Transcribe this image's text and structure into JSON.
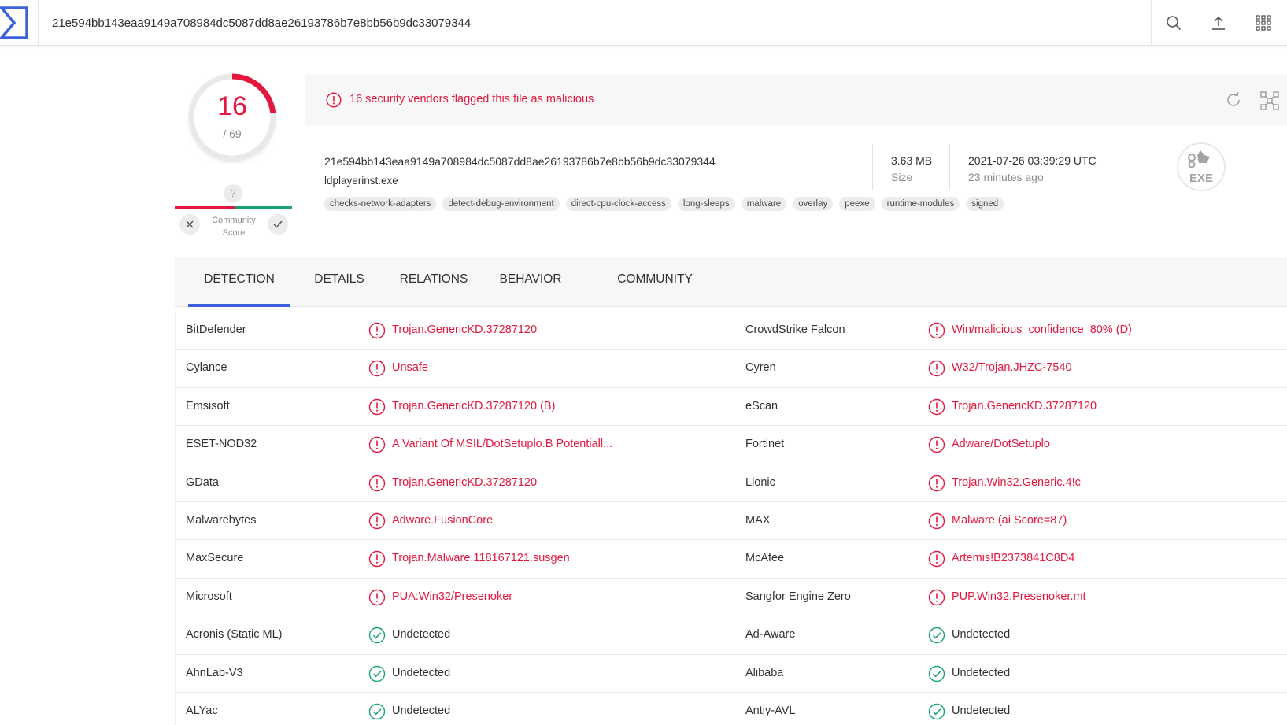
{
  "search": {
    "value": "21e594bb143eaa9149a708984dc5087dd8ae26193786b7e8bb56b9dc33079344"
  },
  "colors": {
    "accent": "#3b61dc",
    "malicious": "#e4173e",
    "clean": "#1aa179"
  },
  "score": {
    "detected": "16",
    "total": "/ 69",
    "fraction": 0.2319
  },
  "community": {
    "question": "?",
    "label_line1": "Community",
    "label_line2": "Score"
  },
  "alert": {
    "text": "16 security vendors flagged this file as malicious"
  },
  "file": {
    "hash": "21e594bb143eaa9149a708984dc5087dd8ae26193786b7e8bb56b9dc33079344",
    "name": "ldplayerinst.exe",
    "size_value": "3.63 MB",
    "size_label": "Size",
    "date_value": "2021-07-26 03:39:29 UTC",
    "date_ago": "23 minutes ago",
    "type_badge": "EXE",
    "tags": [
      "checks-network-adapters",
      "detect-debug-environment",
      "direct-cpu-clock-access",
      "long-sleeps",
      "malware",
      "overlay",
      "peexe",
      "runtime-modules",
      "signed"
    ]
  },
  "tabs": [
    {
      "label": "DETECTION",
      "active": true
    },
    {
      "label": "DETAILS"
    },
    {
      "label": "RELATIONS"
    },
    {
      "label": "BEHAVIOR"
    },
    {
      "label": "COMMUNITY"
    }
  ],
  "detections": [
    {
      "left": {
        "engine": "BitDefender",
        "result": "Trojan.GenericKD.37287120",
        "status": "malicious"
      },
      "right": {
        "engine": "CrowdStrike Falcon",
        "result": "Win/malicious_confidence_80% (D)",
        "status": "malicious"
      }
    },
    {
      "left": {
        "engine": "Cylance",
        "result": "Unsafe",
        "status": "malicious"
      },
      "right": {
        "engine": "Cyren",
        "result": "W32/Trojan.JHZC-7540",
        "status": "malicious"
      }
    },
    {
      "left": {
        "engine": "Emsisoft",
        "result": "Trojan.GenericKD.37287120 (B)",
        "status": "malicious"
      },
      "right": {
        "engine": "eScan",
        "result": "Trojan.GenericKD.37287120",
        "status": "malicious"
      }
    },
    {
      "left": {
        "engine": "ESET-NOD32",
        "result": "A Variant Of MSIL/DotSetuplo.B Potentiall...",
        "status": "malicious"
      },
      "right": {
        "engine": "Fortinet",
        "result": "Adware/DotSetuplo",
        "status": "malicious"
      }
    },
    {
      "left": {
        "engine": "GData",
        "result": "Trojan.GenericKD.37287120",
        "status": "malicious"
      },
      "right": {
        "engine": "Lionic",
        "result": "Trojan.Win32.Generic.4!c",
        "status": "malicious"
      }
    },
    {
      "left": {
        "engine": "Malwarebytes",
        "result": "Adware.FusionCore",
        "status": "malicious"
      },
      "right": {
        "engine": "MAX",
        "result": "Malware (ai Score=87)",
        "status": "malicious"
      }
    },
    {
      "left": {
        "engine": "MaxSecure",
        "result": "Trojan.Malware.118167121.susgen",
        "status": "malicious"
      },
      "right": {
        "engine": "McAfee",
        "result": "Artemis!B2373841C8D4",
        "status": "malicious"
      }
    },
    {
      "left": {
        "engine": "Microsoft",
        "result": "PUA:Win32/Presenoker",
        "status": "malicious"
      },
      "right": {
        "engine": "Sangfor Engine Zero",
        "result": "PUP.Win32.Presenoker.mt",
        "status": "malicious"
      }
    },
    {
      "left": {
        "engine": "Acronis (Static ML)",
        "result": "Undetected",
        "status": "clean"
      },
      "right": {
        "engine": "Ad-Aware",
        "result": "Undetected",
        "status": "clean"
      }
    },
    {
      "left": {
        "engine": "AhnLab-V3",
        "result": "Undetected",
        "status": "clean"
      },
      "right": {
        "engine": "Alibaba",
        "result": "Undetected",
        "status": "clean"
      }
    },
    {
      "left": {
        "engine": "ALYac",
        "result": "Undetected",
        "status": "clean"
      },
      "right": {
        "engine": "Antiy-AVL",
        "result": "Undetected",
        "status": "clean"
      }
    }
  ]
}
